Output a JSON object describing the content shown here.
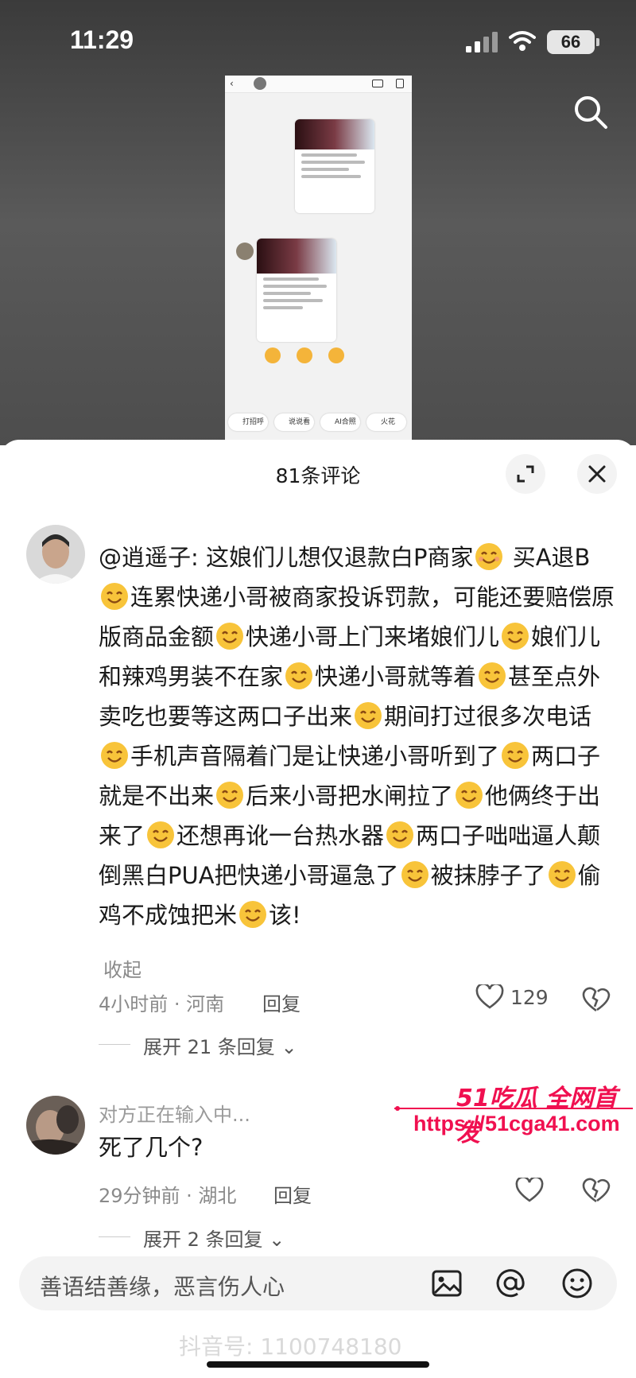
{
  "status_bar": {
    "time": "11:29",
    "battery": "66"
  },
  "thumbnail": {
    "chips": [
      "打招呼",
      "说说看",
      "AI合照",
      "火花"
    ]
  },
  "comments_sheet": {
    "title": "81条评论",
    "comments": [
      {
        "text_segments": [
          "@逍遥子: 这娘们儿想仅退款白P商家",
          " 买A退B",
          "连累快递小哥被商家投诉罚款，可能还要赔偿原版商品金额",
          "快递小哥上门来堵娘们儿",
          "娘们儿和辣鸡男装不在家",
          "快递小哥就等着",
          "甚至点外卖吃也要等这两口子出来",
          "期间打过很多次电话",
          "手机声音隔着门是让快递小哥听到了",
          "两口子就是不出来",
          "后来小哥把水闸拉了",
          "他俩终于出来了",
          "还想再讹一台热水器",
          "两口子咄咄逼人颠倒黑白PUA把快递小哥逼急了",
          "被抹脖子了",
          "偷鸡不成蚀把米",
          "该!"
        ],
        "collapse": "收起",
        "time_location": "4小时前 · 河南",
        "reply": "回复",
        "likes": "129",
        "expand_replies": "展开 21 条回复"
      },
      {
        "typing": "对方正在输入中...",
        "text": "死了几个?",
        "time_location": "29分钟前 · 湖北",
        "reply": "回复",
        "expand_replies": "展开 2 条回复"
      }
    ]
  },
  "watermark": {
    "brand": "51吃瓜 全网首发",
    "url": "https://51cga41.com",
    "bottom": "抖音号: 1100748180"
  },
  "input": {
    "placeholder": "善语结善缘，恶言伤人心"
  },
  "colors": {
    "watermark": "#f01050",
    "sheet_bg": "#ffffff"
  }
}
